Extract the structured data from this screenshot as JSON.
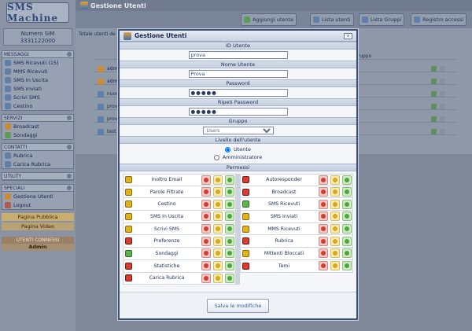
{
  "app": {
    "logo": "SMS Machine",
    "page_title": "Gestione Utenti"
  },
  "sidebar": {
    "sim_label": "Numero SIM",
    "sim_number": "3331122000",
    "sections": [
      {
        "title": "MESSAGGI",
        "items": [
          "SMS Ricevuti (15)",
          "MMS Ricevuti",
          "SMS In Uscita",
          "SMS Inviati",
          "Scrivi SMS",
          "Cestino"
        ]
      },
      {
        "title": "SERVIZI",
        "items": [
          "Broadcast",
          "Sondaggi"
        ]
      },
      {
        "title": "CONTATTI",
        "items": [
          "Rubrica",
          "Carica Rubrica"
        ]
      },
      {
        "title": "UTILITY",
        "items": []
      },
      {
        "title": "SPECIALI",
        "items": [
          "Gestione Utenti",
          "Logout"
        ]
      }
    ],
    "page_links": [
      "Pagina Pubblica",
      "Pagina Video"
    ],
    "connected_title": "UTENTI CONNESSI",
    "connected_user": "Admin"
  },
  "toolbar": {
    "add_user": "Aggiungi utente",
    "user_list": "Lista utenti",
    "group_list": "Lista Gruppi",
    "access_log": "Registro accessi"
  },
  "background": {
    "totale_label": "Totale utenti de",
    "gruppo_header": "Gruppo",
    "rows": [
      "adm",
      "adm",
      "nuov",
      "prov",
      "prov",
      "test"
    ]
  },
  "modal": {
    "title": "Gestione Utenti",
    "close_label": "x",
    "id_label": "ID Utente",
    "id_value": "prova",
    "name_label": "Nome Utente",
    "name_value": "Prova",
    "password_label": "Password",
    "password_value": "●●●●●",
    "repeat_label": "Ripeti Password",
    "repeat_value": "●●●●●",
    "group_label": "Gruppo",
    "group_value": "Users",
    "level_label": "Livello dell'utente",
    "level_options": [
      "Utente",
      "Amministratore"
    ],
    "level_selected": "Utente",
    "permissions_label": "Permessi",
    "save_label": "Salva le modifiche",
    "permissions_left": [
      {
        "name": "Inoltro Email",
        "state": "yellow",
        "options": [
          "red",
          "yellow",
          "green"
        ]
      },
      {
        "name": "Parole Filtrate",
        "state": "yellow",
        "options": [
          "red",
          "yellow",
          "green"
        ]
      },
      {
        "name": "Cestino",
        "state": "yellow",
        "options": [
          "red",
          "yellow",
          "green"
        ]
      },
      {
        "name": "SMS In Uscita",
        "state": "yellow",
        "options": [
          "red",
          "yellow",
          "green"
        ]
      },
      {
        "name": "Scrivi SMS",
        "state": "yellow",
        "options": [
          "red",
          "yellow",
          "green"
        ]
      },
      {
        "name": "Preferenze",
        "state": "red",
        "options": [
          "red",
          "yellow",
          "green"
        ]
      },
      {
        "name": "Sondaggi",
        "state": "green",
        "options": [
          "red",
          "yellow",
          "green"
        ]
      },
      {
        "name": "Statistiche",
        "state": "red",
        "options": [
          "red",
          "yellow",
          "green"
        ]
      },
      {
        "name": "Carica Rubrica",
        "state": "red",
        "options": [
          "red",
          "yellow",
          "green"
        ]
      }
    ],
    "permissions_right": [
      {
        "name": "Autoresponder",
        "state": "red",
        "options": [
          "red",
          "yellow",
          "green"
        ]
      },
      {
        "name": "Broadcast",
        "state": "red",
        "options": [
          "red",
          "yellow",
          "green"
        ]
      },
      {
        "name": "SMS Ricevuti",
        "state": "green",
        "options": [
          "red",
          "yellow",
          "green"
        ]
      },
      {
        "name": "SMS Inviati",
        "state": "yellow",
        "options": [
          "red",
          "yellow",
          "green"
        ]
      },
      {
        "name": "MMS Ricevuti",
        "state": "yellow",
        "options": [
          "red",
          "yellow",
          "green"
        ]
      },
      {
        "name": "Rubrica",
        "state": "red",
        "options": [
          "red",
          "yellow",
          "green"
        ]
      },
      {
        "name": "Mittenti Bloccati",
        "state": "yellow",
        "options": [
          "red",
          "yellow",
          "green"
        ]
      },
      {
        "name": "Temi",
        "state": "red",
        "options": [
          "red",
          "yellow",
          "green"
        ]
      }
    ]
  },
  "colors": {
    "backdrop": "#7e8899",
    "modal_border": "#3c4e7a",
    "accent_blue": "#2f5fa5",
    "state_yellow": "#e2b41f",
    "state_green": "#5db54a",
    "state_red": "#d83b31"
  }
}
